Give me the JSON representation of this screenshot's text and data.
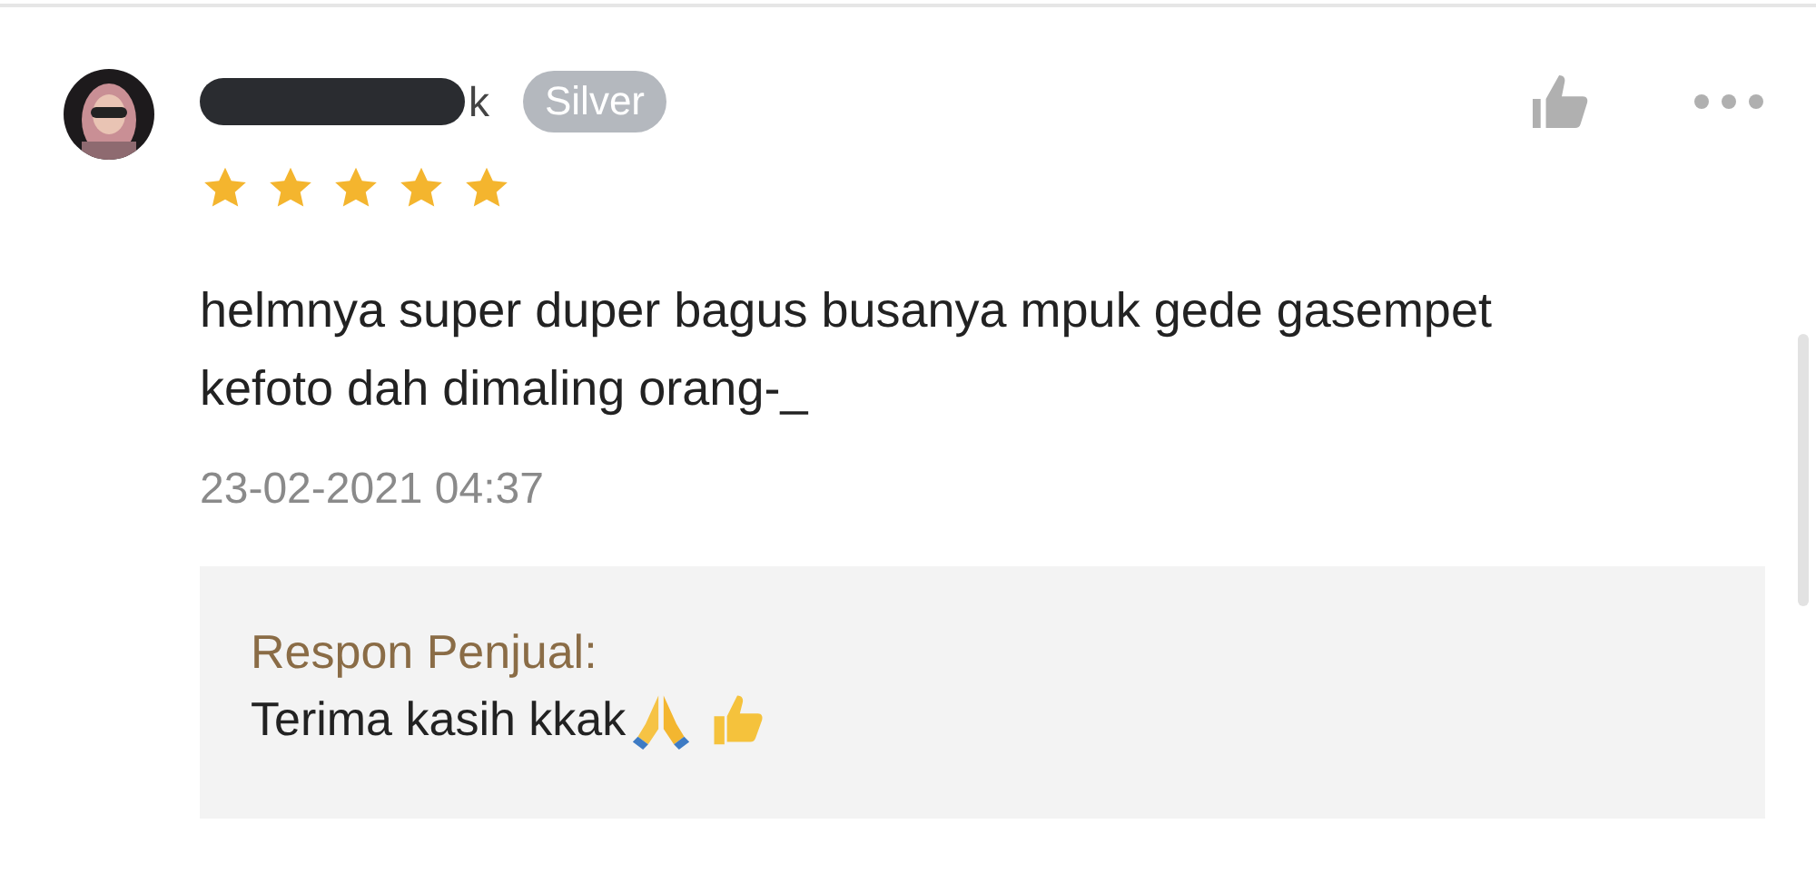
{
  "review": {
    "user": {
      "name_end": "k",
      "badge": "Silver"
    },
    "stars": 5,
    "text": "helmnya super duper bagus busanya mpuk gede gasempet kefoto dah dimaling orang-_",
    "date": "23-02-2021 04:37",
    "reply": {
      "label": "Respon Penjual:",
      "text": "Terima kasih kkak"
    }
  }
}
